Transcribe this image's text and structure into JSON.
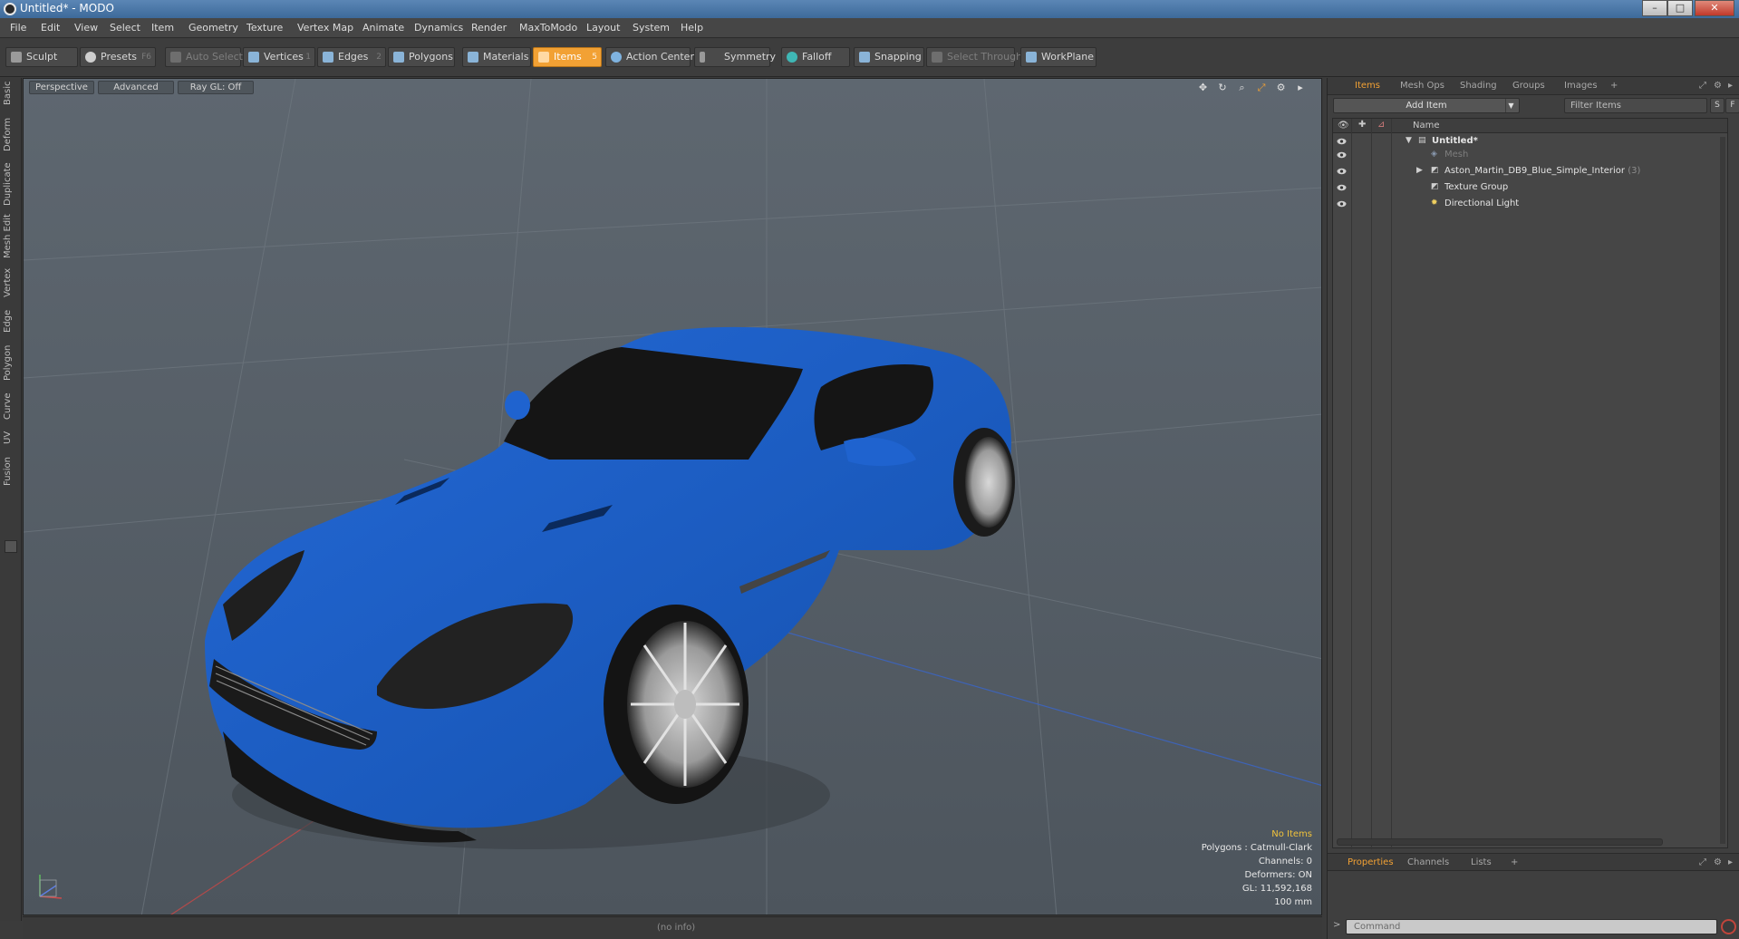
{
  "window": {
    "title": "Untitled* - MODO",
    "minimize": "–",
    "maximize": "□",
    "close": "✕"
  },
  "menu": [
    "File",
    "Edit",
    "View",
    "Select",
    "Item",
    "Geometry",
    "Texture",
    "Vertex Map",
    "Animate",
    "Dynamics",
    "Render",
    "MaxToModo",
    "Layout",
    "System",
    "Help"
  ],
  "toolbar": {
    "sculpt": "Sculpt",
    "presets": "Presets",
    "presets_key": "F6",
    "auto_select": "Auto Select",
    "vertices": "Vertices",
    "vertices_key": "1",
    "edges": "Edges",
    "edges_key": "2",
    "polygons": "Polygons",
    "materials": "Materials",
    "items": "Items",
    "items_key": "5",
    "action_center": "Action Center",
    "symmetry": "Symmetry",
    "falloff": "Falloff",
    "snapping": "Snapping",
    "select_through": "Select Through",
    "workplane": "WorkPlane"
  },
  "left_tabs": [
    "Basic",
    "Deform",
    "Duplicate",
    "Mesh Edit",
    "Vertex",
    "Edge",
    "Polygon",
    "Curve",
    "UV",
    "Fusion"
  ],
  "viewport": {
    "tabs": [
      "Perspective",
      "Advanced",
      "Ray GL: Off"
    ],
    "icons": [
      "move-view-icon",
      "rotate-view-icon",
      "zoom-view-icon",
      "maximize-view-icon",
      "settings-icon",
      "arrow-right-icon"
    ],
    "stats": {
      "selection": "No Items",
      "polygons": "Polygons : Catmull-Clark",
      "channels": "Channels: 0",
      "deformers": "Deformers: ON",
      "gl": "GL: 11,592,168",
      "unit": "100 mm"
    },
    "colors": {
      "car_body": "#1d5cc1",
      "background": "#58616a"
    }
  },
  "status": {
    "info": "(no info)"
  },
  "items_panel": {
    "tabs": [
      "Items",
      "Mesh Ops",
      "Shading",
      "Groups",
      "Images",
      "+"
    ],
    "add_item": "Add Item",
    "filter_placeholder": "Filter Items",
    "s_btn": "S",
    "f_btn": "F",
    "column_name": "Name",
    "rows": [
      {
        "label": "Untitled*",
        "kind": "scene"
      },
      {
        "label": "Mesh",
        "kind": "mesh"
      },
      {
        "label": "Aston_Martin_DB9_Blue_Simple_Interior",
        "count": "(3)",
        "kind": "group"
      },
      {
        "label": "Texture Group",
        "kind": "texture"
      },
      {
        "label": "Directional Light",
        "kind": "light"
      }
    ]
  },
  "properties_panel": {
    "tabs": [
      "Properties",
      "Channels",
      "Lists",
      "+"
    ],
    "command_placeholder": "Command",
    "command_arrow": ">"
  }
}
